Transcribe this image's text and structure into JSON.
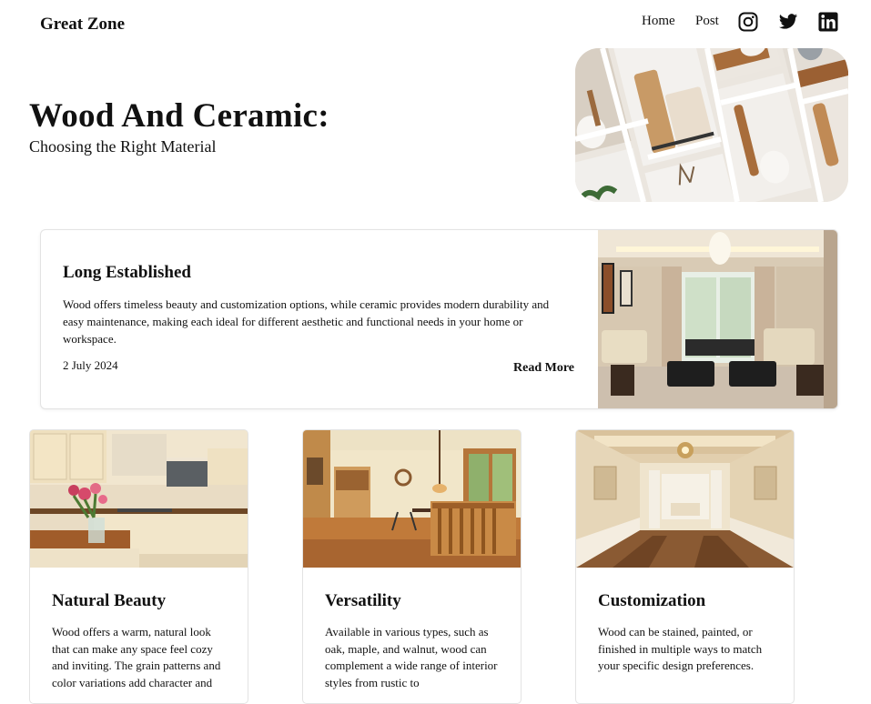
{
  "nav": {
    "brand": "Great Zone",
    "links": [
      {
        "label": "Home"
      },
      {
        "label": "Post"
      }
    ],
    "social": [
      "instagram-icon",
      "twitter-icon",
      "linkedin-icon"
    ]
  },
  "hero": {
    "title": "Wood And Ceramic:",
    "subtitle": "Choosing the Right Material"
  },
  "featured": {
    "title": "Long Established",
    "body": "Wood offers timeless beauty and customization options, while ceramic provides modern durability and easy maintenance, making each ideal for different aesthetic and functional needs in your home or workspace.",
    "date": "2 July 2024",
    "read_more": "Read More"
  },
  "cards": [
    {
      "title": "Natural Beauty",
      "body": "Wood offers a warm, natural look that can make any space feel cozy and inviting. The grain patterns and color variations add character and"
    },
    {
      "title": "Versatility",
      "body": "Available in various types, such as oak, maple, and walnut, wood can complement a wide range of interior styles from rustic to"
    },
    {
      "title": "Customization",
      "body": "Wood can be stained, painted, or finished in multiple ways to match your specific design preferences."
    }
  ],
  "colors": {
    "text": "#111111",
    "border": "#e3e3e3",
    "wood": "#b07a45"
  }
}
